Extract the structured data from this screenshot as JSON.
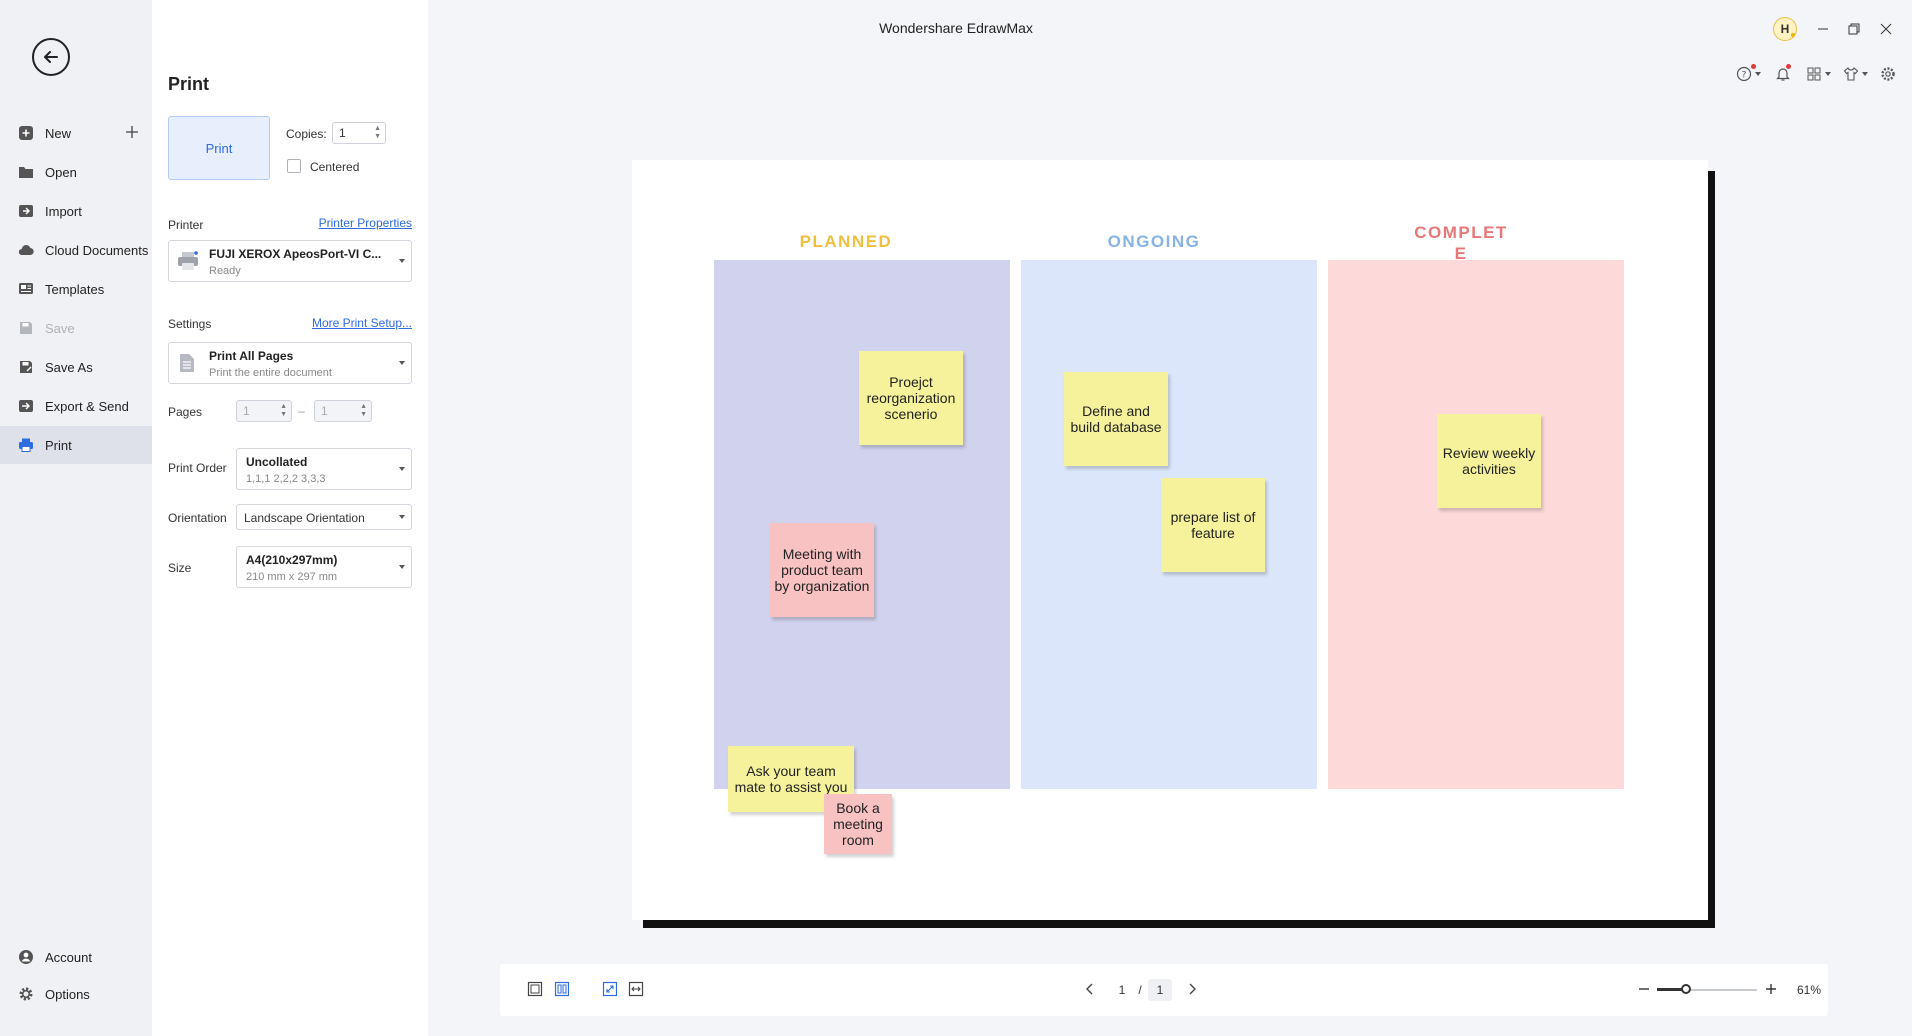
{
  "app": {
    "title": "Wondershare EdrawMax",
    "avatar_letter": "H"
  },
  "nav": {
    "items": [
      {
        "label": "New",
        "icon": "plus-square-icon"
      },
      {
        "label": "Open",
        "icon": "folder-icon"
      },
      {
        "label": "Import",
        "icon": "import-icon"
      },
      {
        "label": "Cloud Documents",
        "icon": "cloud-icon"
      },
      {
        "label": "Templates",
        "icon": "templates-icon"
      },
      {
        "label": "Save",
        "icon": "save-icon"
      },
      {
        "label": "Save As",
        "icon": "save-as-icon"
      },
      {
        "label": "Export & Send",
        "icon": "export-icon"
      },
      {
        "label": "Print",
        "icon": "print-icon"
      }
    ],
    "bottom": [
      {
        "label": "Account",
        "icon": "user-icon"
      },
      {
        "label": "Options",
        "icon": "gear-icon"
      }
    ]
  },
  "print_panel": {
    "title": "Print",
    "print_button": "Print",
    "copies_label": "Copies:",
    "copies_value": "1",
    "centered_label": "Centered",
    "printer_label": "Printer",
    "printer_properties_link": "Printer Properties",
    "printer_name": "FUJI XEROX ApeosPort-VI C...",
    "printer_status": "Ready",
    "settings_label": "Settings",
    "more_setup_link": "More Print Setup...",
    "settings_main": "Print All Pages",
    "settings_sub": "Print the entire document",
    "pages_label": "Pages",
    "pages_from": "1",
    "pages_separator": "–",
    "pages_to": "1",
    "print_order_label": "Print Order",
    "print_order_main": "Uncollated",
    "print_order_sub": "1,1,1  2,2,2  3,3,3",
    "orientation_label": "Orientation",
    "orientation_value": "Landscape Orientation",
    "size_label": "Size",
    "size_main": "A4(210x297mm)",
    "size_sub": "210 mm x 297 mm"
  },
  "board": {
    "columns": [
      {
        "title": "PLANNED",
        "title_color": "#f0bf3c",
        "bg": "#d1d2ed"
      },
      {
        "title": "ONGOING",
        "title_color": "#86b2e6",
        "bg": "#dbe6fa"
      },
      {
        "title": "COMPLET\nE",
        "title_color": "#ea7777",
        "bg": "#fdd9da"
      }
    ],
    "notes": [
      {
        "text": "Proejct reorganization scenerio",
        "color": "#f6f29b"
      },
      {
        "text": "Meeting with product team by organization",
        "color": "#f9c2c2"
      },
      {
        "text": "Ask your team mate to assist you",
        "color": "#f6f29b"
      },
      {
        "text": "Book a meeting room",
        "color": "#f9c2c2"
      },
      {
        "text": "Define and build database",
        "color": "#f6f29b"
      },
      {
        "text": "prepare list of feature",
        "color": "#f6f29b"
      },
      {
        "text": "Review weekly activities",
        "color": "#f6f29b"
      }
    ]
  },
  "bottom_bar": {
    "current_page": "1",
    "page_separator": "/",
    "total_pages": "1",
    "zoom": "61%"
  },
  "colors": {
    "accent": "#2d6be0"
  }
}
